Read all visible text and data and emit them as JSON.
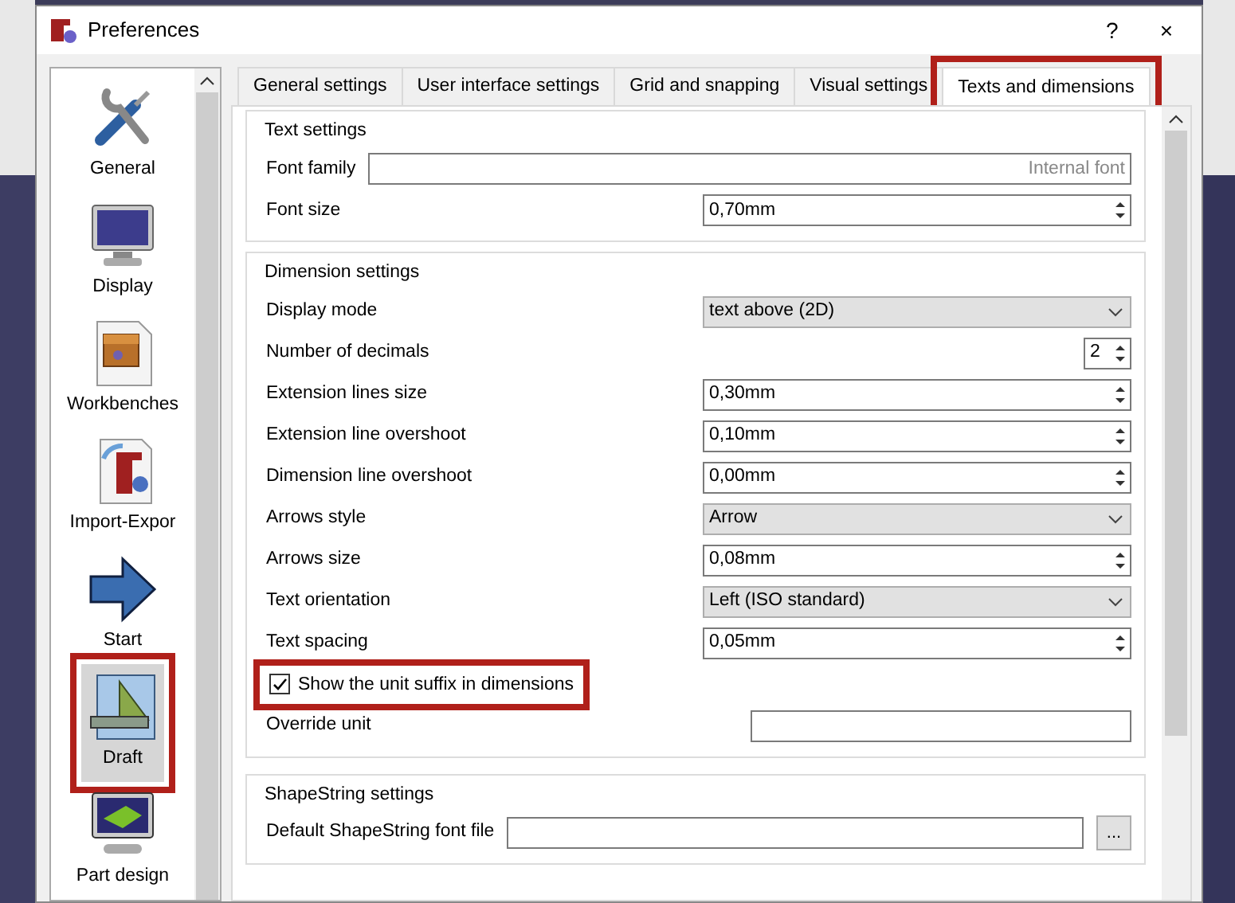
{
  "window": {
    "title": "Preferences",
    "help": "?",
    "close": "×"
  },
  "sidebar": {
    "items": [
      {
        "label": "General",
        "kind": "tools",
        "selected": false,
        "highlighted": false
      },
      {
        "label": "Display",
        "kind": "monitor",
        "selected": false,
        "highlighted": false
      },
      {
        "label": "Workbenches",
        "kind": "box",
        "selected": false,
        "highlighted": false
      },
      {
        "label": "Import-Expor",
        "kind": "document",
        "selected": false,
        "highlighted": false
      },
      {
        "label": "Start",
        "kind": "arrow",
        "selected": false,
        "highlighted": false
      },
      {
        "label": "Draft",
        "kind": "setsquare",
        "selected": true,
        "highlighted": true
      },
      {
        "label": "Part design",
        "kind": "partdesign",
        "selected": false,
        "highlighted": false
      }
    ]
  },
  "tabs": [
    {
      "label": "General settings",
      "selected": false,
      "highlighted": false
    },
    {
      "label": "User interface settings",
      "selected": false,
      "highlighted": false
    },
    {
      "label": "Grid and snapping",
      "selected": false,
      "highlighted": false
    },
    {
      "label": "Visual settings",
      "selected": false,
      "highlighted": false
    },
    {
      "label": "Texts and dimensions",
      "selected": true,
      "highlighted": true
    }
  ],
  "groups": [
    {
      "title": "Text settings",
      "rows": [
        {
          "kind": "font",
          "label": "Font family",
          "placeholder": "Internal font"
        },
        {
          "kind": "spin",
          "label": "Font size",
          "value": "0,70mm"
        }
      ]
    },
    {
      "title": "Dimension settings",
      "rows": [
        {
          "kind": "select",
          "label": "Display mode",
          "value": "text above (2D)"
        },
        {
          "kind": "count",
          "label": "Number of decimals",
          "value": "2"
        },
        {
          "kind": "spin",
          "label": "Extension lines size",
          "value": "0,30mm"
        },
        {
          "kind": "spin",
          "label": "Extension line overshoot",
          "value": "0,10mm"
        },
        {
          "kind": "spin",
          "label": "Dimension line overshoot",
          "value": "0,00mm"
        },
        {
          "kind": "select",
          "label": "Arrows style",
          "value": "Arrow"
        },
        {
          "kind": "spin",
          "label": "Arrows size",
          "value": "0,08mm"
        },
        {
          "kind": "select",
          "label": "Text orientation",
          "value": "Left (ISO standard)"
        },
        {
          "kind": "spin",
          "label": "Text spacing",
          "value": "0,05mm"
        },
        {
          "kind": "check",
          "label": "Show the unit suffix in dimensions",
          "checked": true,
          "highlighted": true
        },
        {
          "kind": "text",
          "label": "Override unit"
        }
      ]
    },
    {
      "title": "ShapeString settings",
      "rows": [
        {
          "kind": "file",
          "label": "Default ShapeString font file",
          "button": "..."
        }
      ]
    }
  ]
}
